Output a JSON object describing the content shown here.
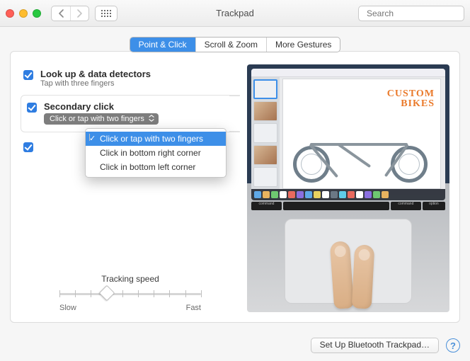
{
  "window": {
    "title": "Trackpad"
  },
  "search": {
    "placeholder": "Search"
  },
  "tabs": {
    "items": [
      "Point & Click",
      "Scroll & Zoom",
      "More Gestures"
    ],
    "active_index": 0
  },
  "options": {
    "lookup": {
      "title": "Look up & data detectors",
      "subtitle": "Tap with three fingers",
      "checked": true
    },
    "secondary": {
      "title": "Secondary click",
      "selected_label": "Click or tap with two fingers",
      "checked": true,
      "menu": [
        "Click or tap with two fingers",
        "Click in bottom right corner",
        "Click in bottom left corner"
      ]
    },
    "third": {
      "checked": true
    }
  },
  "tracking": {
    "label": "Tracking speed",
    "min_label": "Slow",
    "max_label": "Fast",
    "value_index": 3,
    "ticks": 10
  },
  "preview": {
    "page_title_line1": "CUSTOM",
    "page_title_line2": "BIKES",
    "key_labels": [
      "command",
      "",
      "command",
      "option"
    ]
  },
  "footer": {
    "setup_label": "Set Up Bluetooth Trackpad…"
  }
}
